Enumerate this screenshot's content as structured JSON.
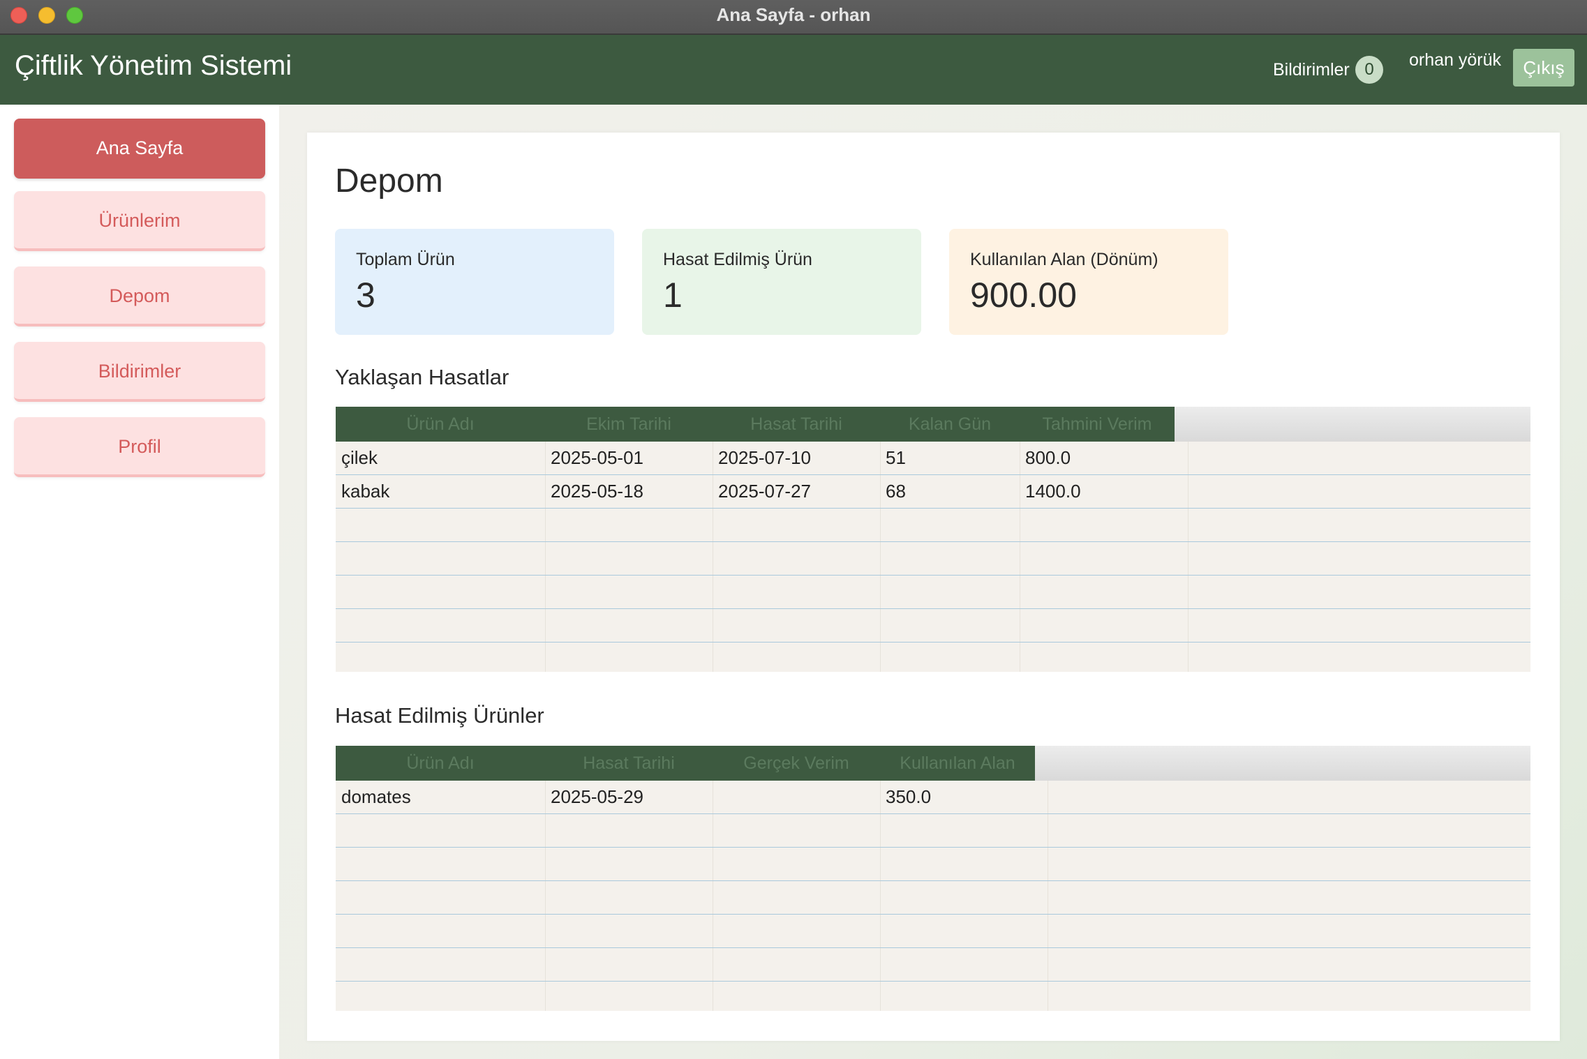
{
  "window": {
    "title": "Ana Sayfa - orhan"
  },
  "header": {
    "app_title": "Çiftlik Yönetim Sistemi",
    "notifications_label": "Bildirimler",
    "notifications_count": "0",
    "user_name": "orhan yörük",
    "logout_label": "Çıkış"
  },
  "sidebar": {
    "items": [
      {
        "label": "Ana Sayfa",
        "active": true
      },
      {
        "label": "Ürünlerim",
        "active": false
      },
      {
        "label": "Depom",
        "active": false
      },
      {
        "label": "Bildirimler",
        "active": false
      },
      {
        "label": "Profil",
        "active": false
      }
    ]
  },
  "main": {
    "title": "Depom",
    "stats": [
      {
        "label": "Toplam Ürün",
        "value": "3",
        "color": "#e3f0fc"
      },
      {
        "label": "Hasat Edilmiş Ürün",
        "value": "1",
        "color": "#e8f5e8"
      },
      {
        "label": "Kullanılan Alan (Dönüm)",
        "value": "900.00",
        "color": "#fef2e2"
      }
    ],
    "upcoming": {
      "title": "Yaklaşan Hasatlar",
      "columns": [
        "Ürün Adı",
        "Ekim Tarihi",
        "Hasat Tarihi",
        "Kalan Gün",
        "Tahmini Verim"
      ],
      "rows": [
        [
          "çilek",
          "2025-05-01",
          "2025-07-10",
          "51",
          "800.0"
        ],
        [
          "kabak",
          "2025-05-18",
          "2025-07-27",
          "68",
          "1400.0"
        ]
      ]
    },
    "harvested": {
      "title": "Hasat Edilmiş Ürünler",
      "columns": [
        "Ürün Adı",
        "Hasat Tarihi",
        "Gerçek Verim",
        "Kullanılan Alan"
      ],
      "rows": [
        [
          "domates",
          "2025-05-29",
          "",
          "350.0"
        ]
      ]
    }
  },
  "colors": {
    "header_green": "#3d5a40",
    "sidebar_active": "#cd5c5c",
    "sidebar_inactive": "#fde1e1",
    "logout_button": "#9cc29b"
  }
}
